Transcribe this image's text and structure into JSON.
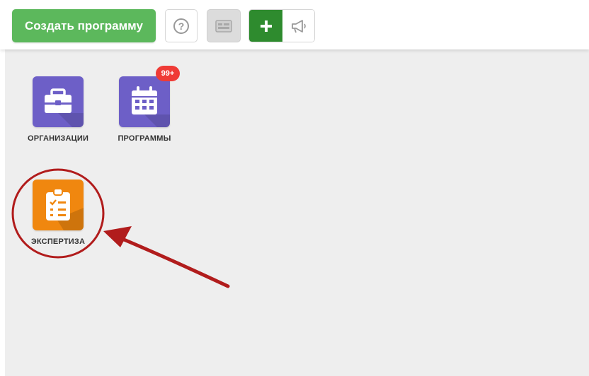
{
  "toolbar": {
    "create_label": "Создать программу",
    "help_icon": "question-circle-icon",
    "widget_icon": "widget-card-icon",
    "plus_icon": "plus-icon",
    "announce_icon": "megaphone-icon"
  },
  "tiles": [
    {
      "label": "ОРГАНИЗАЦИИ",
      "icon": "briefcase-icon",
      "color": "#6d5fc7"
    },
    {
      "label": "ПРОГРАММЫ",
      "icon": "calendar-icon",
      "color": "#6d5fc7",
      "badge": "99+"
    },
    {
      "label": "ЭКСПЕРТИЗА",
      "icon": "clipboard-checklist-icon",
      "color": "#f0870f"
    }
  ],
  "colors": {
    "primary_green": "#5cb85c",
    "dark_green": "#2e8b2e",
    "tile_purple": "#6d5fc7",
    "tile_orange": "#f0870f",
    "badge_red": "#ef3b36",
    "annotation_red": "#b11c1c",
    "workspace_bg": "#eeeeee"
  }
}
